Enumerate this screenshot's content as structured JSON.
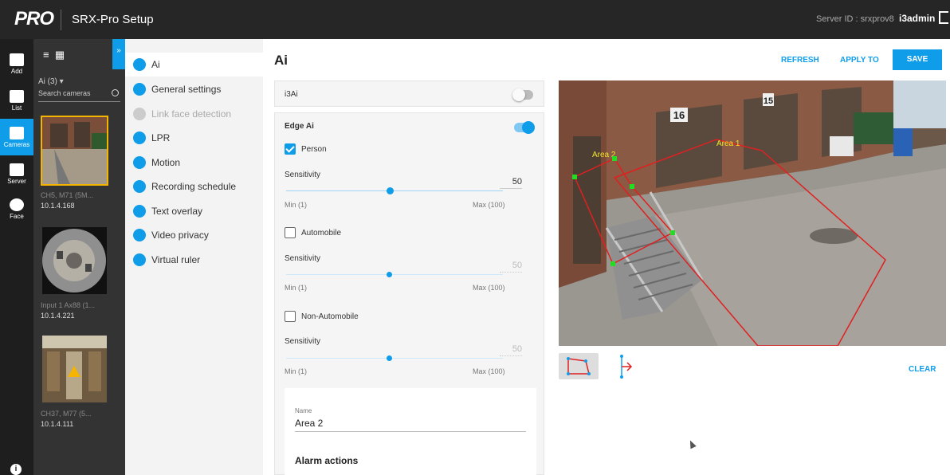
{
  "header": {
    "logo": "PRO",
    "app_title": "SRX-Pro Setup",
    "server_id": "Server ID : srxprov8",
    "user": "i3admin"
  },
  "rail": {
    "items": [
      {
        "label": "Add",
        "icon": "add-camera-icon"
      },
      {
        "label": "List",
        "icon": "list-icon"
      },
      {
        "label": "Cameras",
        "icon": "camera-icon",
        "active": true
      },
      {
        "label": "Server",
        "icon": "server-icon"
      },
      {
        "label": "Face",
        "icon": "face-icon"
      }
    ]
  },
  "camera_panel": {
    "filter_label": "Ai (3)",
    "search_placeholder": "Search cameras",
    "cameras": [
      {
        "name": "CH5, M71 (5M...",
        "ip": "10.1.4.168",
        "selected": true
      },
      {
        "name": "Input 1 Ax88 (1...",
        "ip": "10.1.4.221",
        "selected": false
      },
      {
        "name": "CH37, M77 (5...",
        "ip": "10.1.4.111",
        "selected": false
      }
    ]
  },
  "settings_nav": {
    "items": [
      {
        "label": "Ai",
        "icon": "ai-icon",
        "active": true
      },
      {
        "label": "General settings",
        "icon": "gear-icon"
      },
      {
        "label": "Link face detection",
        "icon": "link-icon",
        "disabled": true
      },
      {
        "label": "LPR",
        "icon": "lpr-icon"
      },
      {
        "label": "Motion",
        "icon": "motion-icon"
      },
      {
        "label": "Recording schedule",
        "icon": "schedule-icon"
      },
      {
        "label": "Text overlay",
        "icon": "text-icon"
      },
      {
        "label": "Video privacy",
        "icon": "privacy-icon"
      },
      {
        "label": "Virtual ruler",
        "icon": "ruler-icon"
      }
    ]
  },
  "main": {
    "title": "Ai",
    "refresh_label": "REFRESH",
    "apply_label": "APPLY TO",
    "save_label": "SAVE",
    "i3ai_label": "i3Ai",
    "i3ai_enabled": false,
    "edge_ai_label": "Edge Ai",
    "edge_ai_enabled": true,
    "detectors": [
      {
        "label": "Person",
        "checked": true,
        "sensitivity_label": "Sensitivity",
        "value": "50",
        "min_label": "Min (1)",
        "max_label": "Max (100)"
      },
      {
        "label": "Automobile",
        "checked": false,
        "sensitivity_label": "Sensitivity",
        "value": "50",
        "min_label": "Min (1)",
        "max_label": "Max (100)"
      },
      {
        "label": "Non-Automobile",
        "checked": false,
        "sensitivity_label": "Sensitivity",
        "value": "50",
        "min_label": "Min (1)",
        "max_label": "Max (100)"
      }
    ],
    "area": {
      "name_label": "Name",
      "name_value": "Area 2",
      "alarm_actions_label": "Alarm actions"
    }
  },
  "preview": {
    "area1_label": "Area 1",
    "area2_label": "Area 2",
    "dock16": "16",
    "dock15": "15",
    "clear_label": "CLEAR"
  },
  "colors": {
    "accent": "#0f9dea",
    "topbar": "#262626",
    "area_outline": "#e02020",
    "area_point": "#22dd22",
    "selected_border": "#f4b400"
  }
}
